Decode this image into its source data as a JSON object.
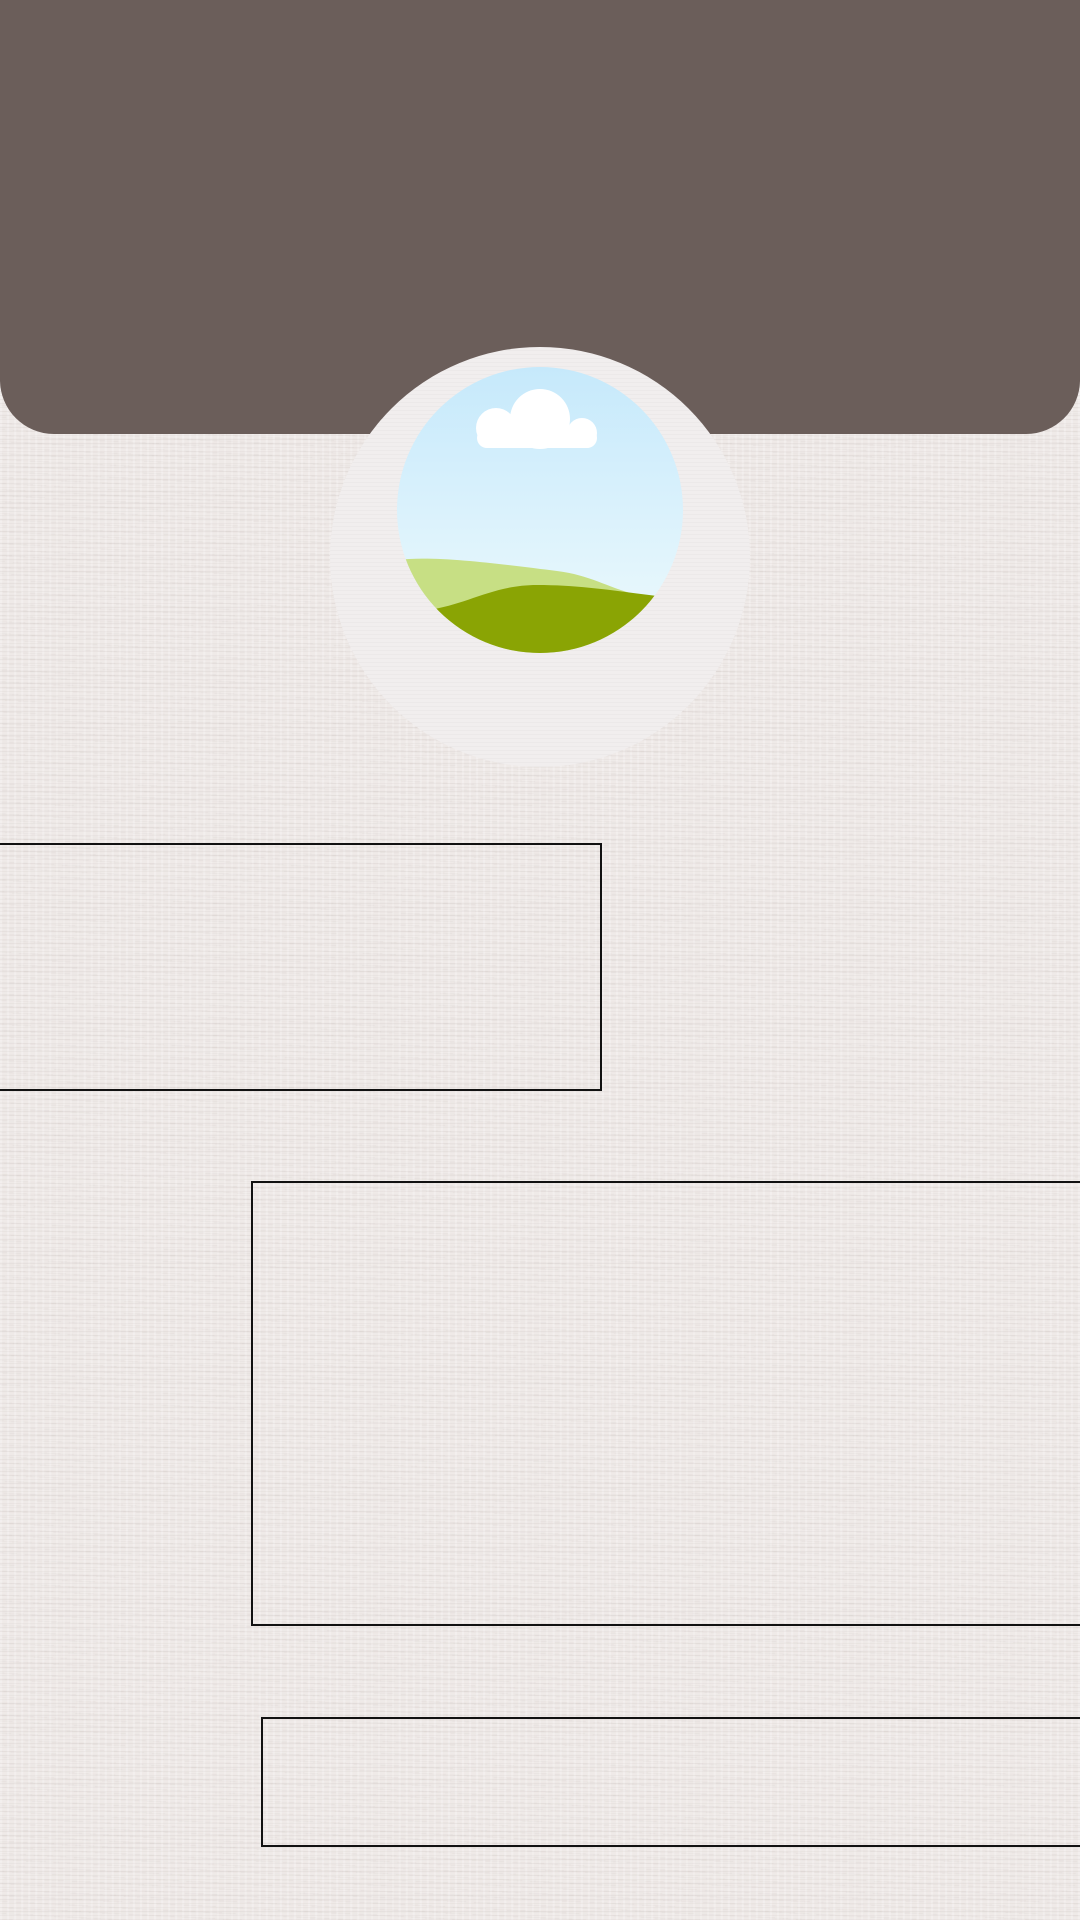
{
  "colors": {
    "header_background": "#6b5e5a",
    "page_background": "#efeae8",
    "ring_background": "#f1eeee",
    "box_border": "#111111",
    "sky_top": "#c6e9fb",
    "sky_bottom": "#eefafd",
    "hill_light": "#c7df84",
    "hill_dark": "#8aa404",
    "cloud": "#ffffff"
  },
  "profile": {
    "photo_icon": "image-placeholder-icon"
  }
}
